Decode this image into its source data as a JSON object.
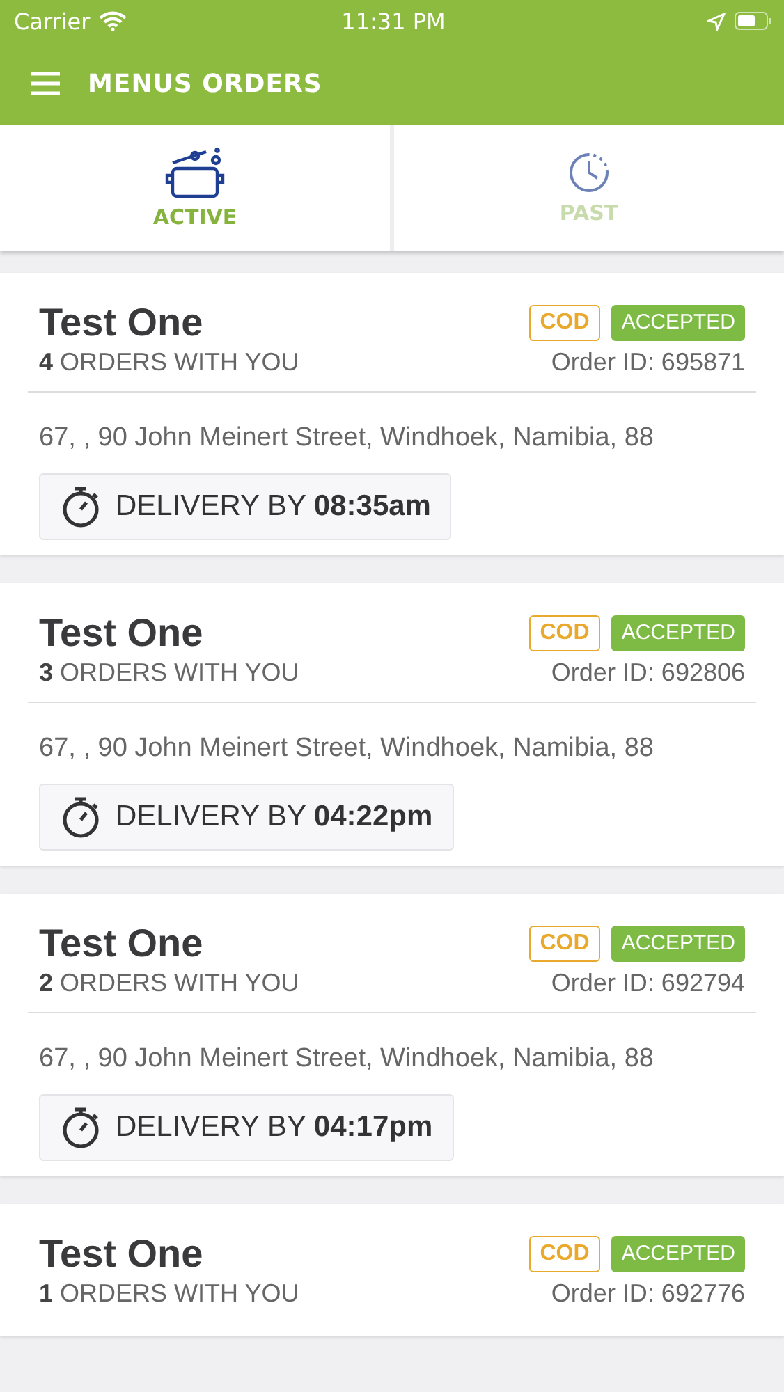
{
  "status_bar": {
    "carrier": "Carrier",
    "time": "11:31 PM"
  },
  "header": {
    "title": "MENUS ORDERS"
  },
  "tabs": [
    {
      "label": "ACTIVE",
      "kind": "pot",
      "selected": true
    },
    {
      "label": "PAST",
      "kind": "clock",
      "selected": false
    }
  ],
  "orders": [
    {
      "name": "Test One",
      "count": "**4** ORDERS WITH YOU",
      "payment": "COD",
      "status": "ACCEPTED",
      "order_id": "Order ID: 695871",
      "address": "67, , 90 John Meinert Street, Windhoek, Namibia,  88",
      "delivery": "DELIVERY BY **08:35am**"
    },
    {
      "name": "Test One",
      "count": "**3** ORDERS WITH YOU",
      "payment": "COD",
      "status": "ACCEPTED",
      "order_id": "Order ID: 692806",
      "address": "67, , 90 John Meinert Street, Windhoek, Namibia,  88",
      "delivery": "DELIVERY BY **04:22pm**"
    },
    {
      "name": "Test One",
      "count": "**2** ORDERS WITH YOU",
      "payment": "COD",
      "status": "ACCEPTED",
      "order_id": "Order ID: 692794",
      "address": "67, , 90 John Meinert Street, Windhoek, Namibia,  88",
      "delivery": "DELIVERY BY **04:17pm**"
    },
    {
      "name": "Test One",
      "count": "**1** ORDERS WITH YOU",
      "payment": "COD",
      "status": "ACCEPTED",
      "order_id": "Order ID: 692776"
    }
  ]
}
